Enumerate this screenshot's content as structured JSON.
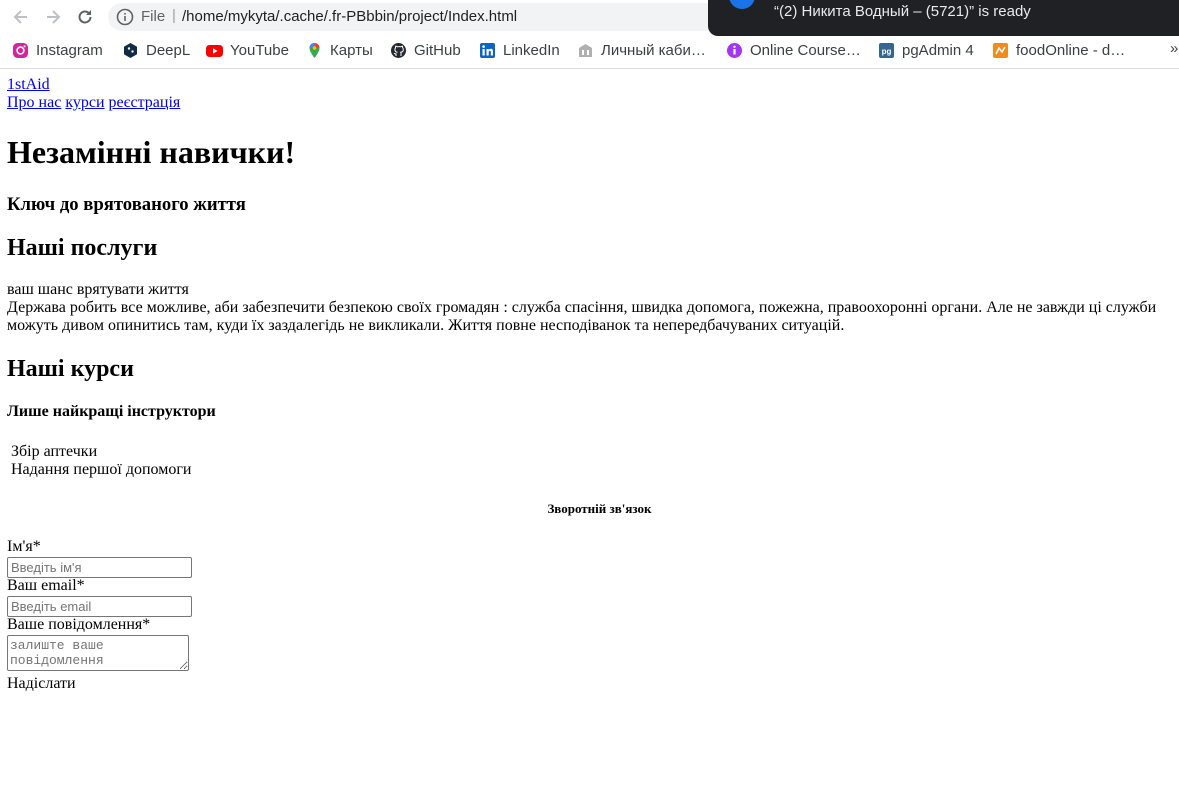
{
  "browser": {
    "scheme": "File",
    "separator": "|",
    "url": "/home/mykyta/.cache/.fr-PBbbin/project/Index.html",
    "bookmarks": [
      {
        "label": "Instagram",
        "icon": "instagram-icon"
      },
      {
        "label": "DeepL",
        "icon": "deepl-icon"
      },
      {
        "label": "YouTube",
        "icon": "youtube-icon"
      },
      {
        "label": "Карты",
        "icon": "maps-icon"
      },
      {
        "label": "GitHub",
        "icon": "github-icon"
      },
      {
        "label": "LinkedIn",
        "icon": "linkedin-icon"
      },
      {
        "label": "Личный каби…",
        "icon": "cabinet-icon"
      },
      {
        "label": "Online Course…",
        "icon": "course-icon"
      },
      {
        "label": "pgAdmin 4",
        "icon": "pgadmin-icon"
      },
      {
        "label": "foodOnline - d…",
        "icon": "foodonline-icon"
      }
    ],
    "more": "»",
    "download_notice": "“(2) Никита Водный – (5721)” is ready"
  },
  "page": {
    "logo": "1stAid",
    "menu": [
      "Про нас",
      "курси",
      "реєстрація"
    ],
    "hero_title": "Незамінні навички!",
    "hero_subtitle": "Ключ до врятованого життя",
    "services_title": "Наші послуги",
    "services_subtitle": "ваш шанс врятувати життя",
    "services_text": "Держава робить все можливе, аби забезпечити безпекою своїх громадян : служба спасіння, швидка допомога, пожежна, правоохоронні органи. Але не завжди ці служби можуть дивом опинитись там, куди їх заздалегідь не викликали. Життя повне несподіванок та непередбачуваних ситуацій.",
    "courses_title": "Наші курси",
    "courses_subtitle": "Лише найкращі інструктори",
    "courses": [
      "Збір аптечки",
      "Надання першої допомоги"
    ],
    "feedback_title": "Зворотній зв'язок",
    "form": {
      "name_label": "Ім'я*",
      "name_placeholder": "Введіть ім'я",
      "email_label": "Ваш email*",
      "email_placeholder": "Введіть email",
      "message_label": "Ваше повідомлення*",
      "message_placeholder": "залиште ваше повідомлення",
      "submit_label": "Надіслати"
    }
  }
}
